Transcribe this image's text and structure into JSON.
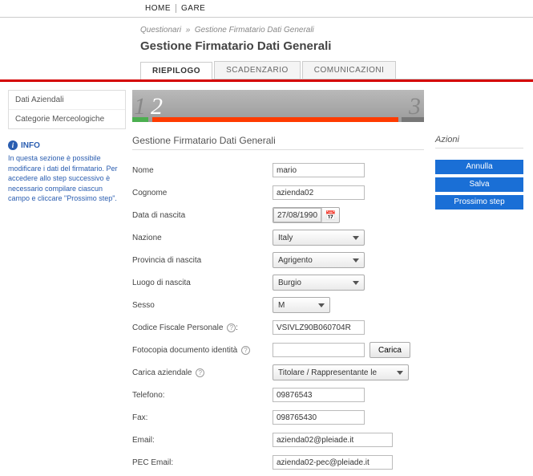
{
  "topnav": {
    "home": "HOME",
    "gare": "GARE"
  },
  "breadcrumb": {
    "parent": "Questionari",
    "current": "Gestione Firmatario Dati Generali"
  },
  "page_title": "Gestione Firmatario Dati Generali",
  "tabs": {
    "riepilogo": "RIEPILOGO",
    "scadenzario": "SCADENZARIO",
    "comunicazioni": "COMUNICAZIONI"
  },
  "sidemenu": {
    "item1": "Dati Aziendali",
    "item2": "Categorie Merceologiche"
  },
  "info": {
    "title": "INFO",
    "body": "In questa sezione è possibile modificare i dati del firmatario. Per accedere allo step successivo è necessario compilare ciascun campo e cliccare \"Prossimo step\"."
  },
  "steps": {
    "s1": "1",
    "s2": "2",
    "s3": "3"
  },
  "section": {
    "title": "Gestione Firmatario Dati Generali",
    "actions_label": "Azioni"
  },
  "actions": {
    "annulla": "Annulla",
    "salva": "Salva",
    "next": "Prossimo step"
  },
  "form": {
    "nome_label": "Nome",
    "nome_value": "mario",
    "cognome_label": "Cognome",
    "cognome_value": "azienda02",
    "datanascita_label": "Data di nascita",
    "datanascita_value": "27/08/1990",
    "nazione_label": "Nazione",
    "nazione_value": "Italy",
    "provincia_label": "Provincia di nascita",
    "provincia_value": "Agrigento",
    "luogo_label": "Luogo di nascita",
    "luogo_value": "Burgio",
    "sesso_label": "Sesso",
    "sesso_value": "M",
    "cf_label": "Codice Fiscale Personale",
    "cf_value": "VSIVLZ90B060704R",
    "doc_label": "Fotocopia documento identità",
    "doc_btn": "Carica",
    "carica_label": "Carica aziendale",
    "carica_value": "Titolare / Rappresentante le",
    "telefono_label": "Telefono:",
    "telefono_value": "09876543",
    "fax_label": "Fax:",
    "fax_value": "098765430",
    "email_label": "Email:",
    "email_value": "azienda02@pleiade.it",
    "pec_label": "PEC Email:",
    "pec_value": "azienda02-pec@pleiade.it"
  }
}
